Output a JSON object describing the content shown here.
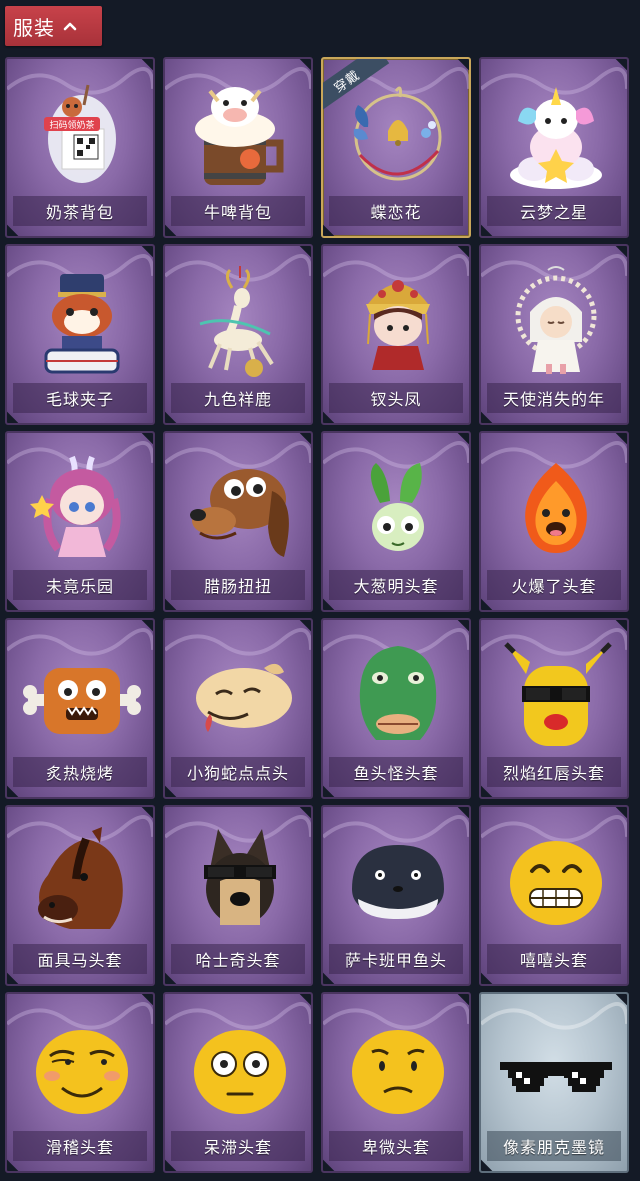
{
  "header": {
    "tab_label": "服装"
  },
  "items": [
    {
      "name": "奶茶背包",
      "icon": "milk-tea-backpack-icon",
      "qr_text": "扫码领奶茶"
    },
    {
      "name": "牛啤背包",
      "icon": "beer-barrel-backpack-icon"
    },
    {
      "name": "蝶恋花",
      "icon": "butterfly-bell-ornament-icon",
      "badge": "穿戴"
    },
    {
      "name": "云梦之星",
      "icon": "unicorn-cloud-icon"
    },
    {
      "name": "毛球夹子",
      "icon": "raccoon-drummer-icon"
    },
    {
      "name": "九色祥鹿",
      "icon": "deer-charm-icon"
    },
    {
      "name": "钗头凤",
      "icon": "phoenix-crown-doll-icon"
    },
    {
      "name": "天使消失的年",
      "icon": "angel-doll-icon"
    },
    {
      "name": "未竟乐园",
      "icon": "pink-hair-doll-icon"
    },
    {
      "name": "腊肠扭扭",
      "icon": "dachshund-head-icon"
    },
    {
      "name": "大葱明头套",
      "icon": "green-onion-mask-icon"
    },
    {
      "name": "火爆了头套",
      "icon": "fire-mask-icon"
    },
    {
      "name": "炙热烧烤",
      "icon": "meat-bone-mask-icon"
    },
    {
      "name": "小狗蛇点点头",
      "icon": "snake-dog-mask-icon"
    },
    {
      "name": "鱼头怪头套",
      "icon": "fish-head-mask-icon"
    },
    {
      "name": "烈焰红唇头套",
      "icon": "pikachu-sunglasses-mask-icon"
    },
    {
      "name": "面具马头套",
      "icon": "horse-head-mask-icon"
    },
    {
      "name": "哈士奇头套",
      "icon": "husky-sunglasses-mask-icon"
    },
    {
      "name": "萨卡班甲鱼头",
      "icon": "sacabambaspis-mask-icon"
    },
    {
      "name": "嘻嘻头套",
      "icon": "grinning-emoji-mask-icon"
    },
    {
      "name": "滑稽头套",
      "icon": "funny-emoji-mask-icon"
    },
    {
      "name": "呆滞头套",
      "icon": "dazed-emoji-mask-icon"
    },
    {
      "name": "卑微头套",
      "icon": "humble-emoji-mask-icon"
    },
    {
      "name": "像素朋克墨镜",
      "icon": "pixel-sunglasses-icon",
      "theme": "pale"
    }
  ],
  "colors": {
    "background": "#141a26",
    "header_tab": "#b83a42",
    "card_purple": "#8a6aa8",
    "card_pale": "#b5c4cf",
    "selected_border": "#c9a75a"
  }
}
